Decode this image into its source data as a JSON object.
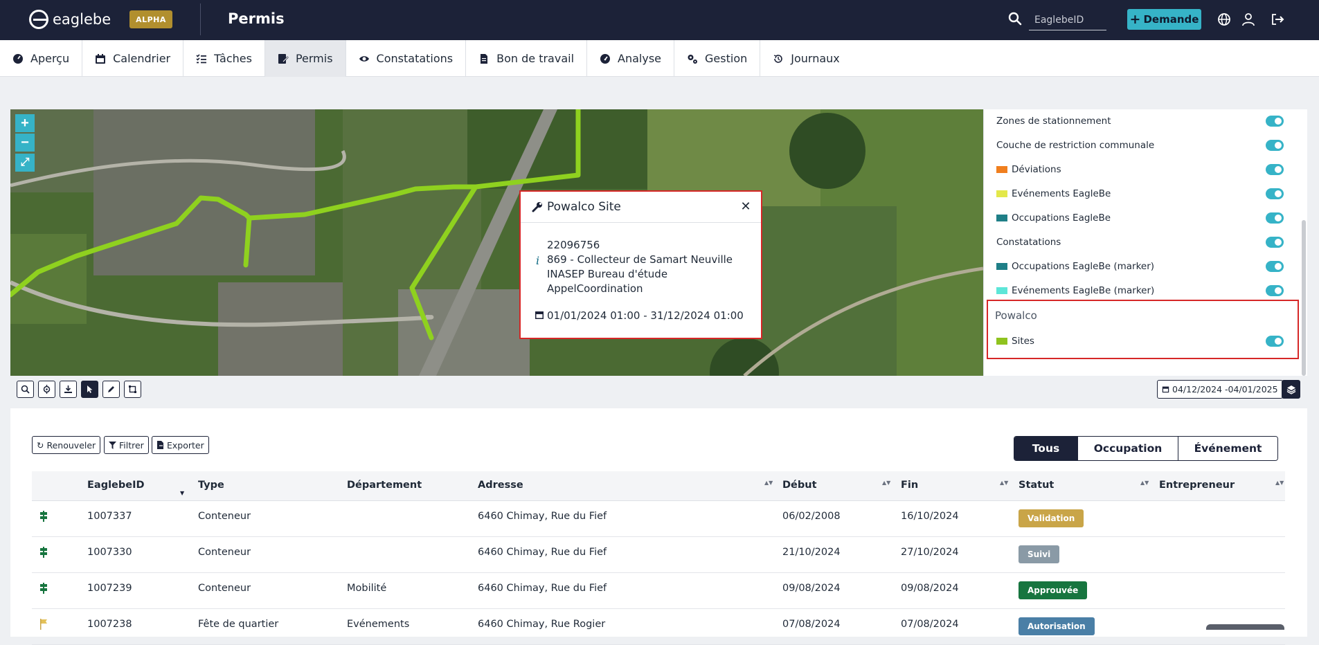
{
  "app": {
    "logo_text": "eaglebe",
    "badge": "ALPHA",
    "title": "Permis",
    "search_placeholder": "EaglebeID",
    "demande_label": "Demande"
  },
  "nav": {
    "items": [
      {
        "label": "Aperçu",
        "icon": "dashboard-icon"
      },
      {
        "label": "Calendrier",
        "icon": "calendar-icon"
      },
      {
        "label": "Tâches",
        "icon": "tasks-icon"
      },
      {
        "label": "Permis",
        "icon": "permit-icon",
        "active": true
      },
      {
        "label": "Constatations",
        "icon": "eye-icon"
      },
      {
        "label": "Bon de travail",
        "icon": "file-icon"
      },
      {
        "label": "Analyse",
        "icon": "gauge-icon"
      },
      {
        "label": "Gestion",
        "icon": "cogs-icon"
      },
      {
        "label": "Journaux",
        "icon": "history-icon"
      }
    ]
  },
  "map": {
    "zoom_in": "+",
    "zoom_out": "−",
    "fullscreen": "⤢"
  },
  "popup": {
    "title": "Powalco Site",
    "id": "22096756",
    "name": "869 - Collecteur de Samart Neuville",
    "org": "INASEP Bureau d'étude",
    "type": "AppelCoordination",
    "dates": "01/01/2024 01:00 - 31/12/2024 01:00"
  },
  "legend": {
    "rows": [
      {
        "label": "Zones de stationnement",
        "color": "",
        "on": true
      },
      {
        "label": "Couche de restriction communale",
        "color": "",
        "on": true
      },
      {
        "label": "Déviations",
        "color": "#f07f1e",
        "on": true
      },
      {
        "label": "Evénements EagleBe",
        "color": "#e3e84a",
        "on": true
      },
      {
        "label": "Occupations EagleBe",
        "color": "#1f7f87",
        "on": true
      },
      {
        "label": "Constatations",
        "color": "",
        "on": true
      },
      {
        "label": "Occupations EagleBe (marker)",
        "color": "#1f7f87",
        "on": true
      },
      {
        "label": "Evénements EagleBe (marker)",
        "color": "#5de6d8",
        "on": true
      }
    ],
    "group_title": "Powalco",
    "group_rows": [
      {
        "label": "Sites",
        "color": "#8fc31f",
        "on": true
      }
    ]
  },
  "toolbar": {
    "date_range": "04/12/2024 -04/01/2025"
  },
  "actions": {
    "renew": "Renouveler",
    "filter": "Filtrer",
    "export": "Exporter"
  },
  "segments": {
    "all": "Tous",
    "occupation": "Occupation",
    "event": "Événement"
  },
  "table": {
    "columns": [
      "EaglebeID",
      "Type",
      "Département",
      "Adresse",
      "Début",
      "Fin",
      "Statut",
      "Entrepreneur"
    ],
    "rows": [
      {
        "id": "1007337",
        "type": "Conteneur",
        "dept": "",
        "address": "6460 Chimay, Rue du Fief",
        "start": "06/02/2008",
        "end": "16/10/2024",
        "status": "Validation",
        "status_color": "#c9a548"
      },
      {
        "id": "1007330",
        "type": "Conteneur",
        "dept": "",
        "address": "6460 Chimay, Rue du Fief",
        "start": "21/10/2024",
        "end": "27/10/2024",
        "status": "Suivi",
        "status_color": "#8a9aa6"
      },
      {
        "id": "1007239",
        "type": "Conteneur",
        "dept": "Mobilité",
        "address": "6460 Chimay, Rue du Fief",
        "start": "09/08/2024",
        "end": "09/08/2024",
        "status": "Approuvée",
        "status_color": "#17753f"
      },
      {
        "id": "1007238",
        "type": "Fête de quartier",
        "dept": "Evénements",
        "address": "6460 Chimay, Rue Rogier",
        "start": "07/08/2024",
        "end": "07/08/2024",
        "status": "Autorisation",
        "status_color": "#4a7fa6"
      }
    ]
  }
}
